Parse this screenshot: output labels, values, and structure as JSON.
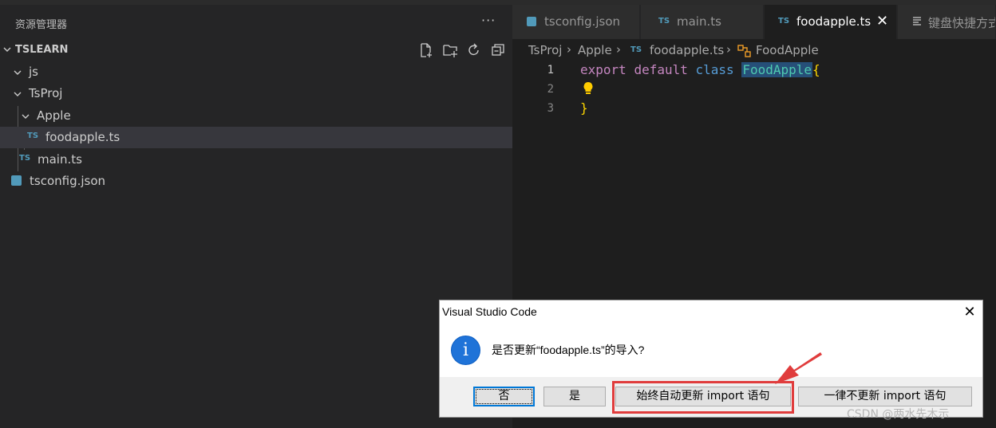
{
  "sidebar": {
    "title": "资源管理器",
    "more": "···",
    "section": "TSLEARN",
    "tree": [
      {
        "label": "js",
        "type": "folder"
      },
      {
        "label": "TsProj",
        "type": "folder"
      },
      {
        "label": "Apple",
        "type": "folder"
      },
      {
        "label": "foodapple.ts",
        "type": "ts",
        "icon_text": "TS",
        "selected": true
      },
      {
        "label": "main.ts",
        "type": "ts",
        "icon_text": "TS"
      },
      {
        "label": "tsconfig.json",
        "type": "json"
      }
    ]
  },
  "tabs": [
    {
      "label": "tsconfig.json",
      "icon": "json-icon"
    },
    {
      "label": "main.ts",
      "icon_text": "TS"
    },
    {
      "label": "foodapple.ts",
      "icon_text": "TS",
      "active": true,
      "close": "✕"
    },
    {
      "label": "键盘快捷方式",
      "icon": "keyboard-shortcuts-icon"
    }
  ],
  "breadcrumb": {
    "items": [
      "TsProj",
      "Apple",
      "foodapple.ts",
      "FoodApple"
    ],
    "ts_icon": "TS",
    "sep": "›"
  },
  "code": {
    "line_numbers": [
      "1",
      "2",
      "3"
    ],
    "line1": {
      "kw1": "export",
      "kw2": "default",
      "kw3": "class",
      "cls": "FoodApple",
      "brace": "{"
    },
    "line3": {
      "brace": "}"
    }
  },
  "dialog": {
    "title": "Visual Studio Code",
    "close": "✕",
    "info_glyph": "i",
    "message": "是否更新“foodapple.ts”的导入?",
    "buttons": {
      "no": "否",
      "yes": "是",
      "always": "始终自动更新 import 语句",
      "never": "一律不更新 import 语句"
    }
  },
  "watermark": "CSDN @两水先木示",
  "colors": {
    "highlight": "#e03c3c",
    "ts_blue": "#519aba",
    "accent": "#0078d7"
  }
}
